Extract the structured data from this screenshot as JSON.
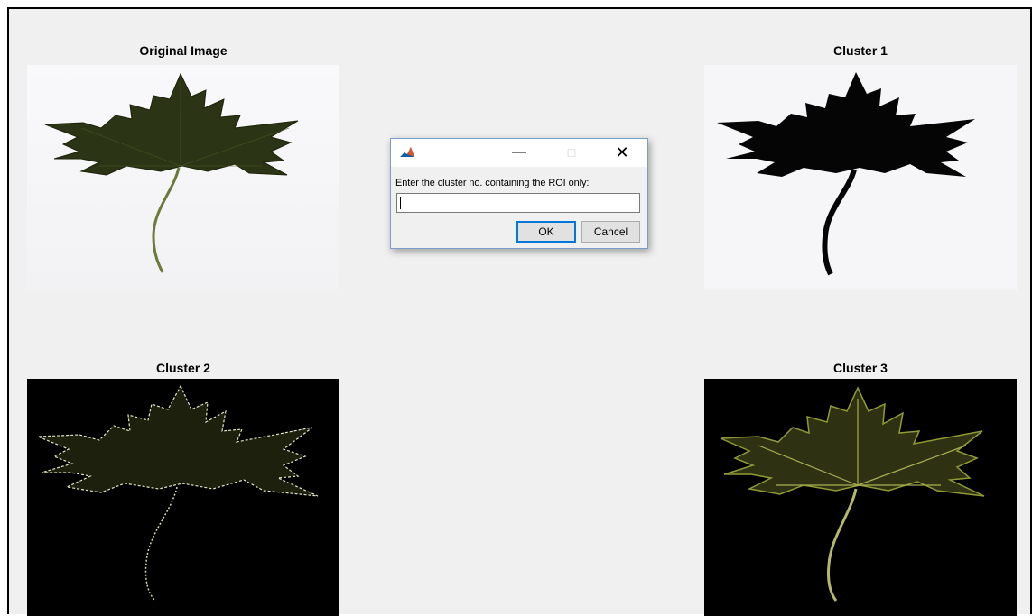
{
  "figure": {
    "panels": [
      {
        "title": "Original Image"
      },
      {
        "title": "Cluster 1"
      },
      {
        "title": "Cluster 2"
      },
      {
        "title": "Cluster 3"
      }
    ]
  },
  "dialog": {
    "icon": "matlab-icon",
    "minimize_icon": "minimize-icon",
    "maximize_icon": "maximize-icon",
    "close_icon": "close-icon",
    "prompt": "Enter the cluster no. containing the ROI only:",
    "input_value": "",
    "ok_label": "OK",
    "cancel_label": "Cancel"
  },
  "colors": {
    "leaf_dark": "#2b3414",
    "leaf_outline": "#d8e0c0",
    "leaf_yellow": "#9aa23a",
    "accent": "#0078d7"
  }
}
